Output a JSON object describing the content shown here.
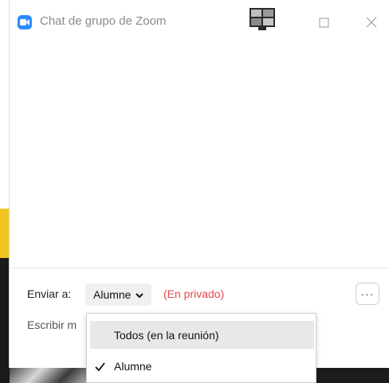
{
  "window": {
    "title": "Chat de grupo de Zoom"
  },
  "composer": {
    "send_to_label": "Enviar a:",
    "recipient": "Alumne",
    "private_note": "(En privado)",
    "message_placeholder": "Escribir m",
    "more_label": "···"
  },
  "recipient_menu": {
    "options": [
      {
        "label": "Todos (en la reunión)",
        "checked": false,
        "hovered": true
      },
      {
        "label": "Alumne",
        "checked": true,
        "hovered": false
      }
    ]
  },
  "colors": {
    "zoom_blue": "#2d8cff",
    "private_red": "#e8474e",
    "background_yellow": "#f1c31f"
  },
  "icons": [
    "zoom-app-icon",
    "gallery-view-icon",
    "maximize-icon",
    "close-icon",
    "chevron-down-icon",
    "more-icon",
    "checkmark-icon"
  ]
}
